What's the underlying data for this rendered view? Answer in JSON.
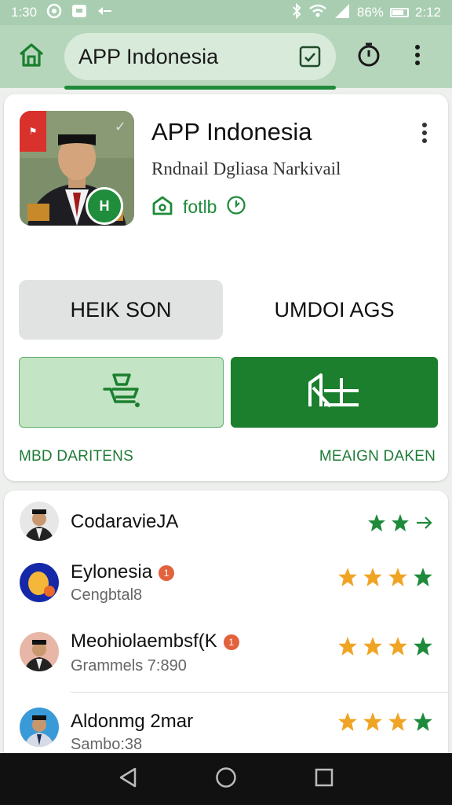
{
  "status_bar": {
    "time_left": "1:30",
    "battery": "86%",
    "time_right": "2:12",
    "icons": [
      "settings-icon",
      "media-icon",
      "signal-arrows-icon",
      "bluetooth-icon",
      "wifi-icon",
      "cell-signal-icon",
      "battery-icon"
    ]
  },
  "app_bar": {
    "title": "APP Indonesia",
    "icons": [
      "home-icon",
      "check-box-icon",
      "timer-icon",
      "more-vertical-icon"
    ]
  },
  "profile": {
    "title": "APP Indonesia",
    "subtitle": "Rndnail Dgliasa Narkivail",
    "meta": "fotlb",
    "corner_badge": "⚑",
    "emblem_text": "H"
  },
  "tabs": {
    "active": "HEIK SON",
    "inactive": "UMDOI AGS"
  },
  "actions": {
    "left_caption": "MBD DARITENS",
    "right_caption": "MEAIGN DAKEN"
  },
  "list": [
    {
      "name": "CodaravieJA",
      "sub": "",
      "badge": false,
      "rating": 0,
      "trailing": "arrow"
    },
    {
      "name": "Eylonesia",
      "sub": "Cengbtal8",
      "badge": true,
      "badge_text": "1",
      "rating": 4
    },
    {
      "name": "Meohiolaembsf(K",
      "sub": "Grammels 7:890",
      "badge": true,
      "badge_text": "1",
      "rating": 4
    },
    {
      "name": "Aldonmg 2mar",
      "sub": "Sambo:38",
      "badge": false,
      "rating": 4
    }
  ],
  "colors": {
    "brand_green": "#1b7f2d",
    "light_green": "#c4e4c6",
    "app_bar": "#b6d6bc",
    "star_gold": "#f0a424",
    "star_green": "#1e8a3a"
  }
}
